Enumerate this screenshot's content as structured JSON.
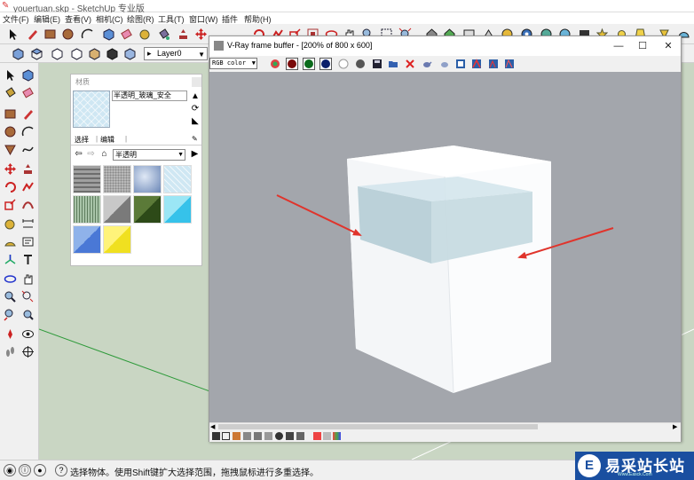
{
  "window": {
    "title": "youertuan.skp - SketchUp 专业版"
  },
  "menu": [
    "文件(F)",
    "编辑(E)",
    "查看(V)",
    "相机(C)",
    "绘图(R)",
    "工具(T)",
    "窗口(W)",
    "插件",
    "帮助(H)"
  ],
  "layer_select": {
    "value": "Layer0"
  },
  "materials": {
    "panel_title": "材质",
    "material_name": "半透明_玻璃_安全",
    "tabs": [
      "选择",
      "编辑"
    ],
    "category": "半透明",
    "swatch_color": "#cfe7f3",
    "thumbnails": [
      "gray-tile",
      "gray-noise",
      "cloud-blue",
      "cross-hatch-blue",
      "green-stripes",
      "gray-triangle",
      "dark-green-triangle",
      "cyan-triangle",
      "blue-triangle",
      "yellow-triangle"
    ]
  },
  "vfb": {
    "title": "V-Ray frame buffer - [200% of 800 x 600]",
    "channel": "RGB color",
    "window_buttons": {
      "minimize": "—",
      "maximize": "☐",
      "close": "✕"
    },
    "background_color": "#a3a6ac",
    "annotation_color": "#e0342c"
  },
  "statusbar": {
    "hint": "选择物体。使用Shift键扩大选择范围，拖拽鼠标进行多重选择。"
  },
  "watermark": {
    "mark": "E",
    "name": "易采站长站",
    "url": "Www.Easck.Com"
  }
}
